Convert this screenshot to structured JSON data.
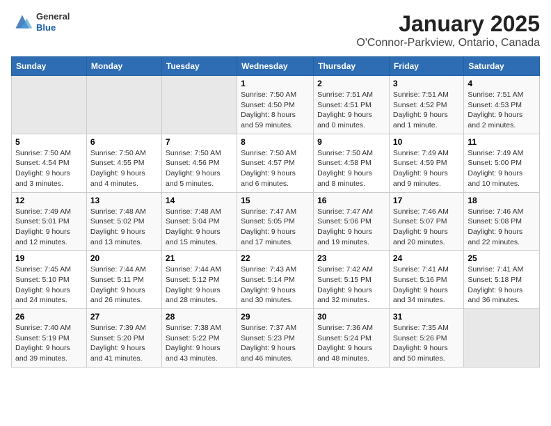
{
  "header": {
    "logo_general": "General",
    "logo_blue": "Blue",
    "title": "January 2025",
    "subtitle": "O'Connor-Parkview, Ontario, Canada"
  },
  "days_of_week": [
    "Sunday",
    "Monday",
    "Tuesday",
    "Wednesday",
    "Thursday",
    "Friday",
    "Saturday"
  ],
  "weeks": [
    [
      {
        "day": "",
        "info": ""
      },
      {
        "day": "",
        "info": ""
      },
      {
        "day": "",
        "info": ""
      },
      {
        "day": "1",
        "info": "Sunrise: 7:50 AM\nSunset: 4:50 PM\nDaylight: 8 hours\nand 59 minutes."
      },
      {
        "day": "2",
        "info": "Sunrise: 7:51 AM\nSunset: 4:51 PM\nDaylight: 9 hours\nand 0 minutes."
      },
      {
        "day": "3",
        "info": "Sunrise: 7:51 AM\nSunset: 4:52 PM\nDaylight: 9 hours\nand 1 minute."
      },
      {
        "day": "4",
        "info": "Sunrise: 7:51 AM\nSunset: 4:53 PM\nDaylight: 9 hours\nand 2 minutes."
      }
    ],
    [
      {
        "day": "5",
        "info": "Sunrise: 7:50 AM\nSunset: 4:54 PM\nDaylight: 9 hours\nand 3 minutes."
      },
      {
        "day": "6",
        "info": "Sunrise: 7:50 AM\nSunset: 4:55 PM\nDaylight: 9 hours\nand 4 minutes."
      },
      {
        "day": "7",
        "info": "Sunrise: 7:50 AM\nSunset: 4:56 PM\nDaylight: 9 hours\nand 5 minutes."
      },
      {
        "day": "8",
        "info": "Sunrise: 7:50 AM\nSunset: 4:57 PM\nDaylight: 9 hours\nand 6 minutes."
      },
      {
        "day": "9",
        "info": "Sunrise: 7:50 AM\nSunset: 4:58 PM\nDaylight: 9 hours\nand 8 minutes."
      },
      {
        "day": "10",
        "info": "Sunrise: 7:49 AM\nSunset: 4:59 PM\nDaylight: 9 hours\nand 9 minutes."
      },
      {
        "day": "11",
        "info": "Sunrise: 7:49 AM\nSunset: 5:00 PM\nDaylight: 9 hours\nand 10 minutes."
      }
    ],
    [
      {
        "day": "12",
        "info": "Sunrise: 7:49 AM\nSunset: 5:01 PM\nDaylight: 9 hours\nand 12 minutes."
      },
      {
        "day": "13",
        "info": "Sunrise: 7:48 AM\nSunset: 5:02 PM\nDaylight: 9 hours\nand 13 minutes."
      },
      {
        "day": "14",
        "info": "Sunrise: 7:48 AM\nSunset: 5:04 PM\nDaylight: 9 hours\nand 15 minutes."
      },
      {
        "day": "15",
        "info": "Sunrise: 7:47 AM\nSunset: 5:05 PM\nDaylight: 9 hours\nand 17 minutes."
      },
      {
        "day": "16",
        "info": "Sunrise: 7:47 AM\nSunset: 5:06 PM\nDaylight: 9 hours\nand 19 minutes."
      },
      {
        "day": "17",
        "info": "Sunrise: 7:46 AM\nSunset: 5:07 PM\nDaylight: 9 hours\nand 20 minutes."
      },
      {
        "day": "18",
        "info": "Sunrise: 7:46 AM\nSunset: 5:08 PM\nDaylight: 9 hours\nand 22 minutes."
      }
    ],
    [
      {
        "day": "19",
        "info": "Sunrise: 7:45 AM\nSunset: 5:10 PM\nDaylight: 9 hours\nand 24 minutes."
      },
      {
        "day": "20",
        "info": "Sunrise: 7:44 AM\nSunset: 5:11 PM\nDaylight: 9 hours\nand 26 minutes."
      },
      {
        "day": "21",
        "info": "Sunrise: 7:44 AM\nSunset: 5:12 PM\nDaylight: 9 hours\nand 28 minutes."
      },
      {
        "day": "22",
        "info": "Sunrise: 7:43 AM\nSunset: 5:14 PM\nDaylight: 9 hours\nand 30 minutes."
      },
      {
        "day": "23",
        "info": "Sunrise: 7:42 AM\nSunset: 5:15 PM\nDaylight: 9 hours\nand 32 minutes."
      },
      {
        "day": "24",
        "info": "Sunrise: 7:41 AM\nSunset: 5:16 PM\nDaylight: 9 hours\nand 34 minutes."
      },
      {
        "day": "25",
        "info": "Sunrise: 7:41 AM\nSunset: 5:18 PM\nDaylight: 9 hours\nand 36 minutes."
      }
    ],
    [
      {
        "day": "26",
        "info": "Sunrise: 7:40 AM\nSunset: 5:19 PM\nDaylight: 9 hours\nand 39 minutes."
      },
      {
        "day": "27",
        "info": "Sunrise: 7:39 AM\nSunset: 5:20 PM\nDaylight: 9 hours\nand 41 minutes."
      },
      {
        "day": "28",
        "info": "Sunrise: 7:38 AM\nSunset: 5:22 PM\nDaylight: 9 hours\nand 43 minutes."
      },
      {
        "day": "29",
        "info": "Sunrise: 7:37 AM\nSunset: 5:23 PM\nDaylight: 9 hours\nand 46 minutes."
      },
      {
        "day": "30",
        "info": "Sunrise: 7:36 AM\nSunset: 5:24 PM\nDaylight: 9 hours\nand 48 minutes."
      },
      {
        "day": "31",
        "info": "Sunrise: 7:35 AM\nSunset: 5:26 PM\nDaylight: 9 hours\nand 50 minutes."
      },
      {
        "day": "",
        "info": ""
      }
    ]
  ]
}
